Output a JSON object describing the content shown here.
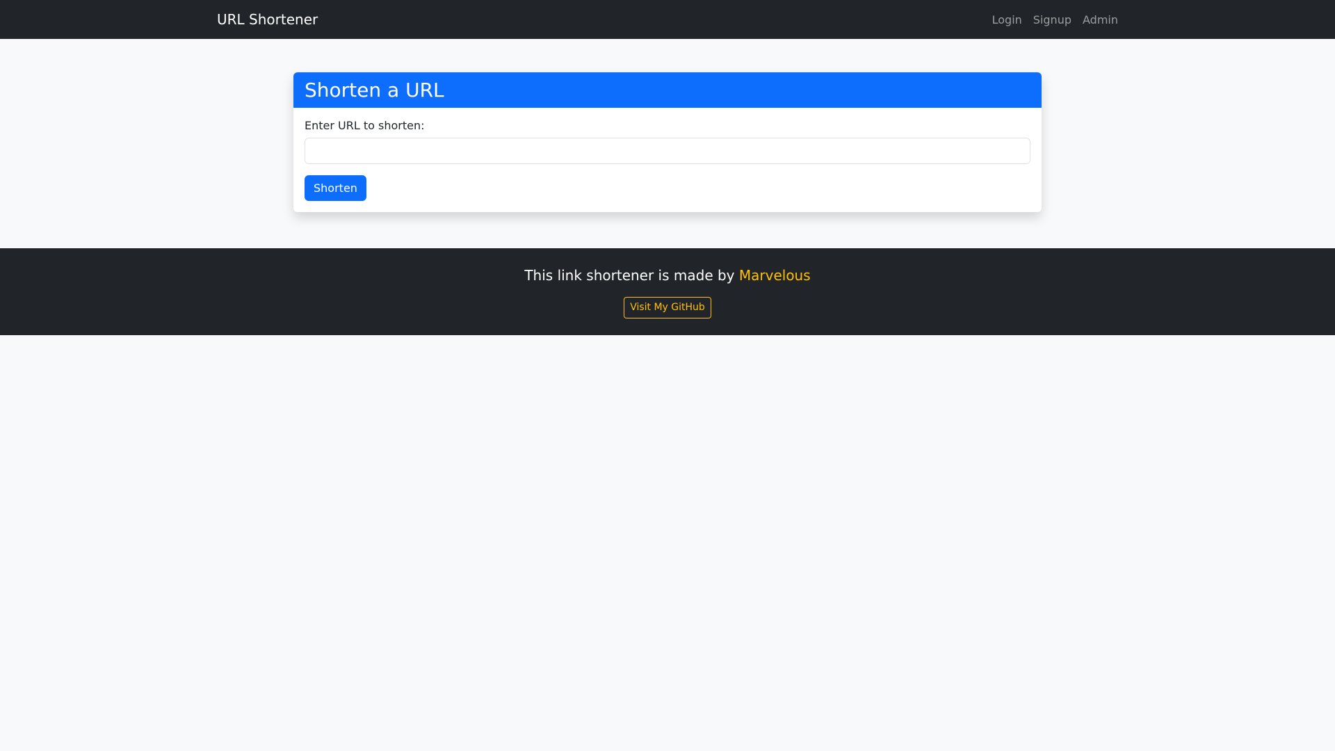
{
  "navbar": {
    "brand": "URL Shortener",
    "links": [
      {
        "label": "Login"
      },
      {
        "label": "Signup"
      },
      {
        "label": "Admin"
      }
    ]
  },
  "card": {
    "title": "Shorten a URL",
    "label": "Enter URL to shorten:",
    "input_value": "",
    "button_label": "Shorten"
  },
  "footer": {
    "text": "This link shortener is made by",
    "author": "Marvelous",
    "github_button": "Visit My GitHub"
  },
  "colors": {
    "navbar_bg": "#212529",
    "primary": "#0d6efd",
    "accent": "#ffc107",
    "page_bg": "#f8f9fa"
  }
}
